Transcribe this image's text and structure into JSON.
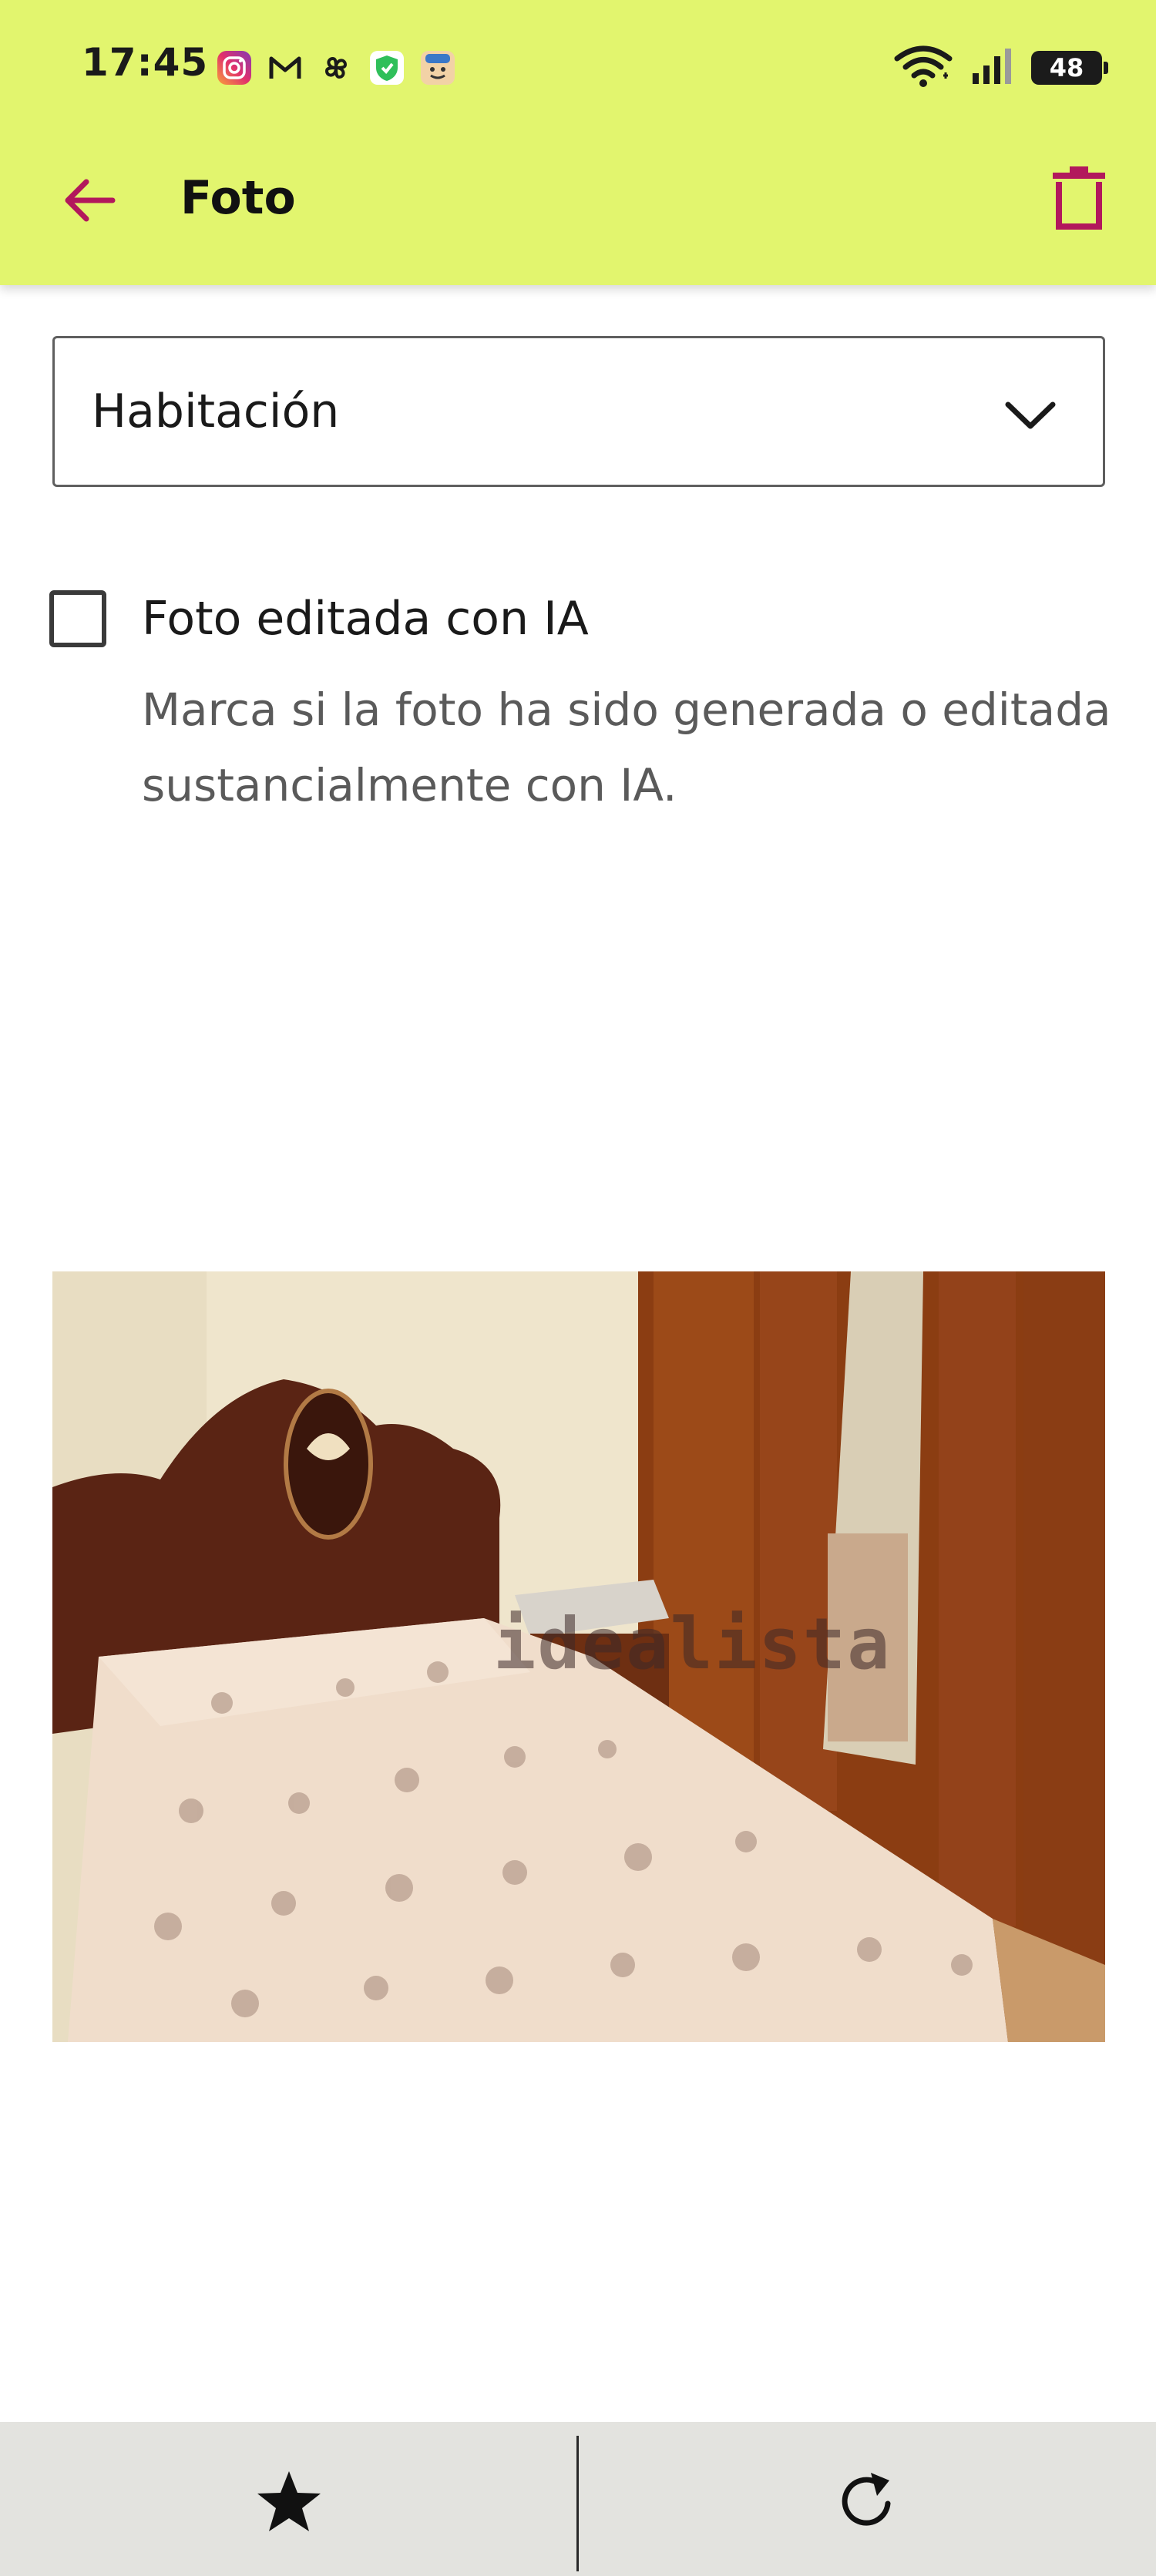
{
  "status_bar": {
    "time": "17:45",
    "battery": "48",
    "icons": [
      "instagram-icon",
      "gmail-icon",
      "pinwheel-icon",
      "vpn-shield-icon",
      "face-app-icon",
      "wifi-icon",
      "signal-icon",
      "battery-icon"
    ]
  },
  "app_bar": {
    "title": "Foto",
    "back_icon": "arrow-left-icon",
    "delete_icon": "trash-icon",
    "accent_color": "#b2185c",
    "background_color": "#e2f56e"
  },
  "category_select": {
    "value": "Habitación",
    "icon": "chevron-down-icon"
  },
  "ai_checkbox": {
    "checked": false,
    "label": "Foto editada con IA",
    "description": "Marca si la foto ha sido generada o editada sustancialmente con IA."
  },
  "photo": {
    "watermark": "idealista"
  },
  "bottom_bar": {
    "star_icon": "star-icon",
    "rotate_icon": "rotate-icon"
  }
}
